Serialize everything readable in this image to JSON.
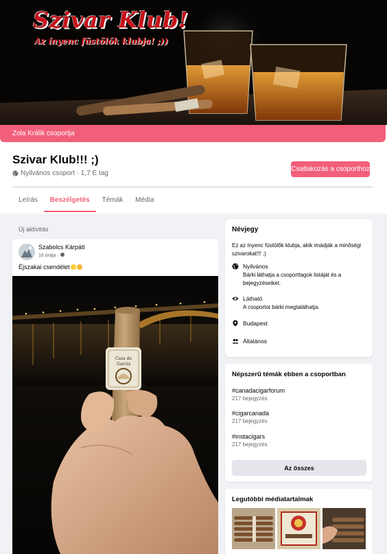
{
  "cover": {
    "title": "Szivar Klub!",
    "subtitle": "Az ínyenc füstölők klubja! ;))",
    "owner_text": "Zola Králik csoportja"
  },
  "group": {
    "name": "Szivar Klub!!! ;)",
    "meta": "Nyilvános csoport · 1,7 E tag",
    "join_label": "Csatlakozás a csoporthoz"
  },
  "tabs": [
    "Leírás",
    "Beszélgetés",
    "Témák",
    "Média"
  ],
  "active_tab": "Beszélgetés",
  "feed": {
    "section_label": "Új aktivitás",
    "post": {
      "author": "Szabolcs Kárpáti",
      "time": "16 órája · ",
      "text": "Éjszakai csendélet",
      "cigar_band": "Casa de Garcia"
    }
  },
  "about": {
    "title": "Névjegy",
    "description": "Ez az ínyenc füstölők klubja, akik imádják a minőségi szivarokat!!! ;)",
    "privacy_title": "Nyilvános",
    "privacy_desc": "Bárki láthatja a csoporttagok listáját és a bejegyzéseiket.",
    "visibility_title": "Látható",
    "visibility_desc": "A csoportot bárki megtalálhatja.",
    "location": "Budapest",
    "category": "Általános"
  },
  "topics": {
    "title": "Népszerű témák ebben a csoportban",
    "items": [
      {
        "tag": "#canadacigarforum",
        "count": "217 bejegyzés"
      },
      {
        "tag": "#cigarcanada",
        "count": "217 bejegyzés"
      },
      {
        "tag": "#instacigars",
        "count": "217 bejegyzés"
      }
    ],
    "all_label": "Az összes"
  },
  "media": {
    "title": "Legutóbbi médiatartalmak"
  },
  "colors": {
    "accent": "#f25f7b",
    "text": "#050505",
    "secondary_text": "#65676b",
    "page_bg": "#f0f2f5"
  }
}
